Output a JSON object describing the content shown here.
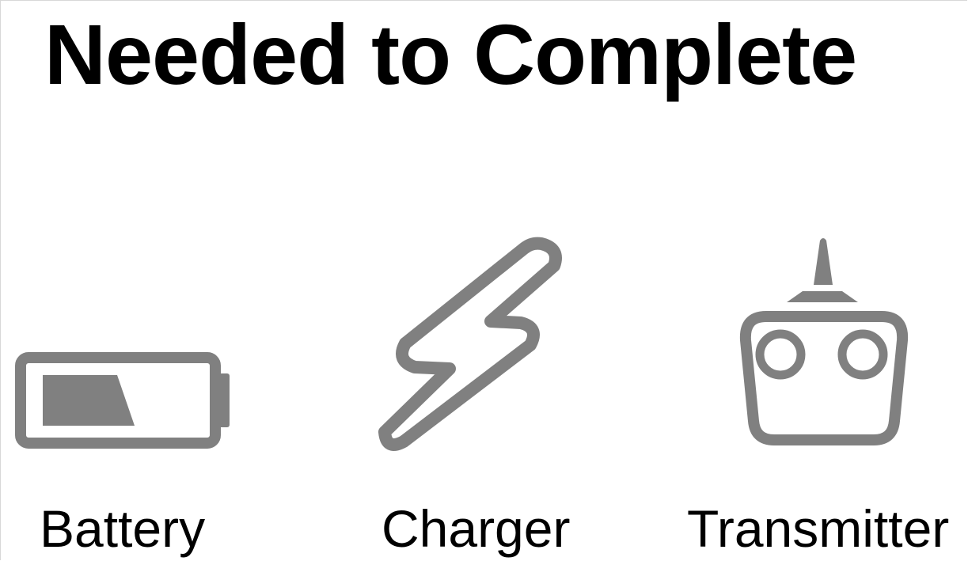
{
  "title": "Needed to Complete",
  "items": [
    {
      "label": "Battery",
      "icon": "battery-icon"
    },
    {
      "label": "Charger",
      "icon": "lightning-bolt-icon"
    },
    {
      "label": "Transmitter",
      "icon": "remote-control-transmitter-icon"
    }
  ],
  "colors": {
    "text": "#000000",
    "icon": "#808080",
    "background": "#ffffff"
  }
}
